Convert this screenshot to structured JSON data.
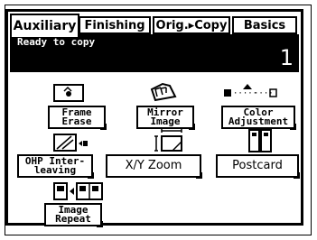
{
  "tabs": [
    {
      "label": "Auxiliary",
      "active": true
    },
    {
      "label": "Finishing",
      "active": false
    },
    {
      "label": "Orig.▸Copy",
      "active": false
    },
    {
      "label": "Basics",
      "active": false
    }
  ],
  "status": {
    "message": "Ready to copy",
    "copy_count": "1"
  },
  "functions": {
    "frame_erase": {
      "line1": "Frame",
      "line2": "Erase",
      "icon": "frame-erase-icon"
    },
    "mirror_image": {
      "line1": "Mirror",
      "line2": "Image",
      "icon": "mirror-image-icon"
    },
    "color_adjustment": {
      "line1": "Color",
      "line2": "Adjustment",
      "icon": "color-adjustment-icon"
    },
    "ohp_interleaving": {
      "line1": "OHP Inter-",
      "line2": "leaving",
      "icon": "ohp-interleaving-icon"
    },
    "xy_zoom": {
      "label": "X/Y Zoom",
      "icon": "xy-zoom-icon"
    },
    "postcard": {
      "label": "Postcard",
      "icon": "postcard-icon"
    },
    "image_repeat": {
      "line1": "Image",
      "line2": "Repeat",
      "icon": "image-repeat-icon"
    }
  }
}
